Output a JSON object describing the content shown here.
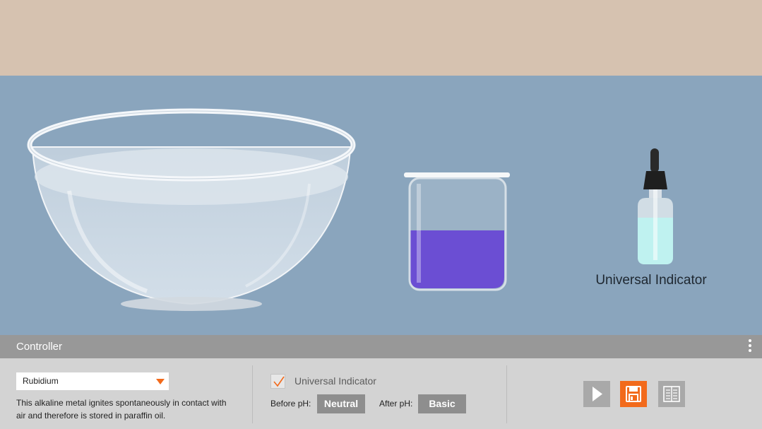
{
  "scene": {
    "indicator_label": "Universal Indicator",
    "beaker_solution_color": "#6b4ed3",
    "dropper_liquid_color": "#bff2f0",
    "wall_color": "#d6c2b0",
    "bench_color": "#8aa5bd"
  },
  "controller": {
    "title": "Controller",
    "menu_icon": "kebab-menu-icon",
    "element_select": {
      "value": "Rubidium",
      "icon": "chevron-down-icon"
    },
    "description": "This alkaline metal ignites spontaneously in contact with air and therefore is stored in paraffin oil.",
    "indicator_checkbox": {
      "label": "Universal Indicator",
      "checked": true
    },
    "before_ph": {
      "label": "Before pH:",
      "value": "Neutral"
    },
    "after_ph": {
      "label": "After pH:",
      "value": "Basic"
    },
    "buttons": {
      "play_icon": "play-icon",
      "save_icon": "save-icon",
      "sheet_icon": "worksheet-icon"
    },
    "accent_color": "#f26a1b"
  }
}
